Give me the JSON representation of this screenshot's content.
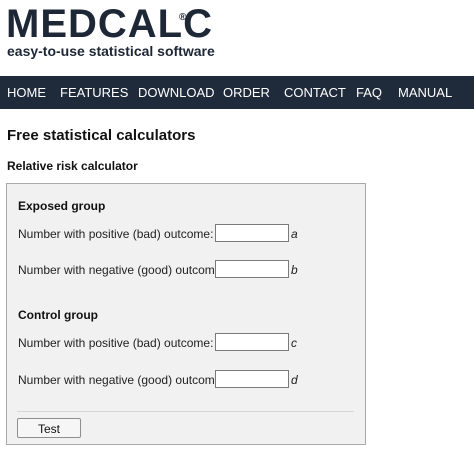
{
  "header": {
    "logo_text": "MEDCALC",
    "registered_mark": "®",
    "tagline": "easy-to-use statistical software"
  },
  "nav": {
    "items": [
      "HOME",
      "FEATURES",
      "DOWNLOAD",
      "ORDER",
      "CONTACT",
      "FAQ",
      "MANUAL"
    ]
  },
  "page": {
    "heading": "Free statistical calculators",
    "calculator_title": "Relative risk calculator"
  },
  "form": {
    "exposed_group": {
      "title": "Exposed group",
      "positive_label": "Number with positive (bad) outcome:",
      "positive_value": "",
      "positive_var": "a",
      "negative_label": "Number with negative (good) outcome:",
      "negative_value": "",
      "negative_var": "b"
    },
    "control_group": {
      "title": "Control group",
      "positive_label": "Number with positive (bad) outcome:",
      "positive_value": "",
      "positive_var": "c",
      "negative_label": "Number with negative (good) outcome:",
      "negative_value": "",
      "negative_var": "d"
    },
    "test_button": "Test"
  },
  "colors": {
    "nav_background": "#1f2a3a",
    "brand": "#1d2735",
    "panel_background": "#f1f1f1"
  }
}
